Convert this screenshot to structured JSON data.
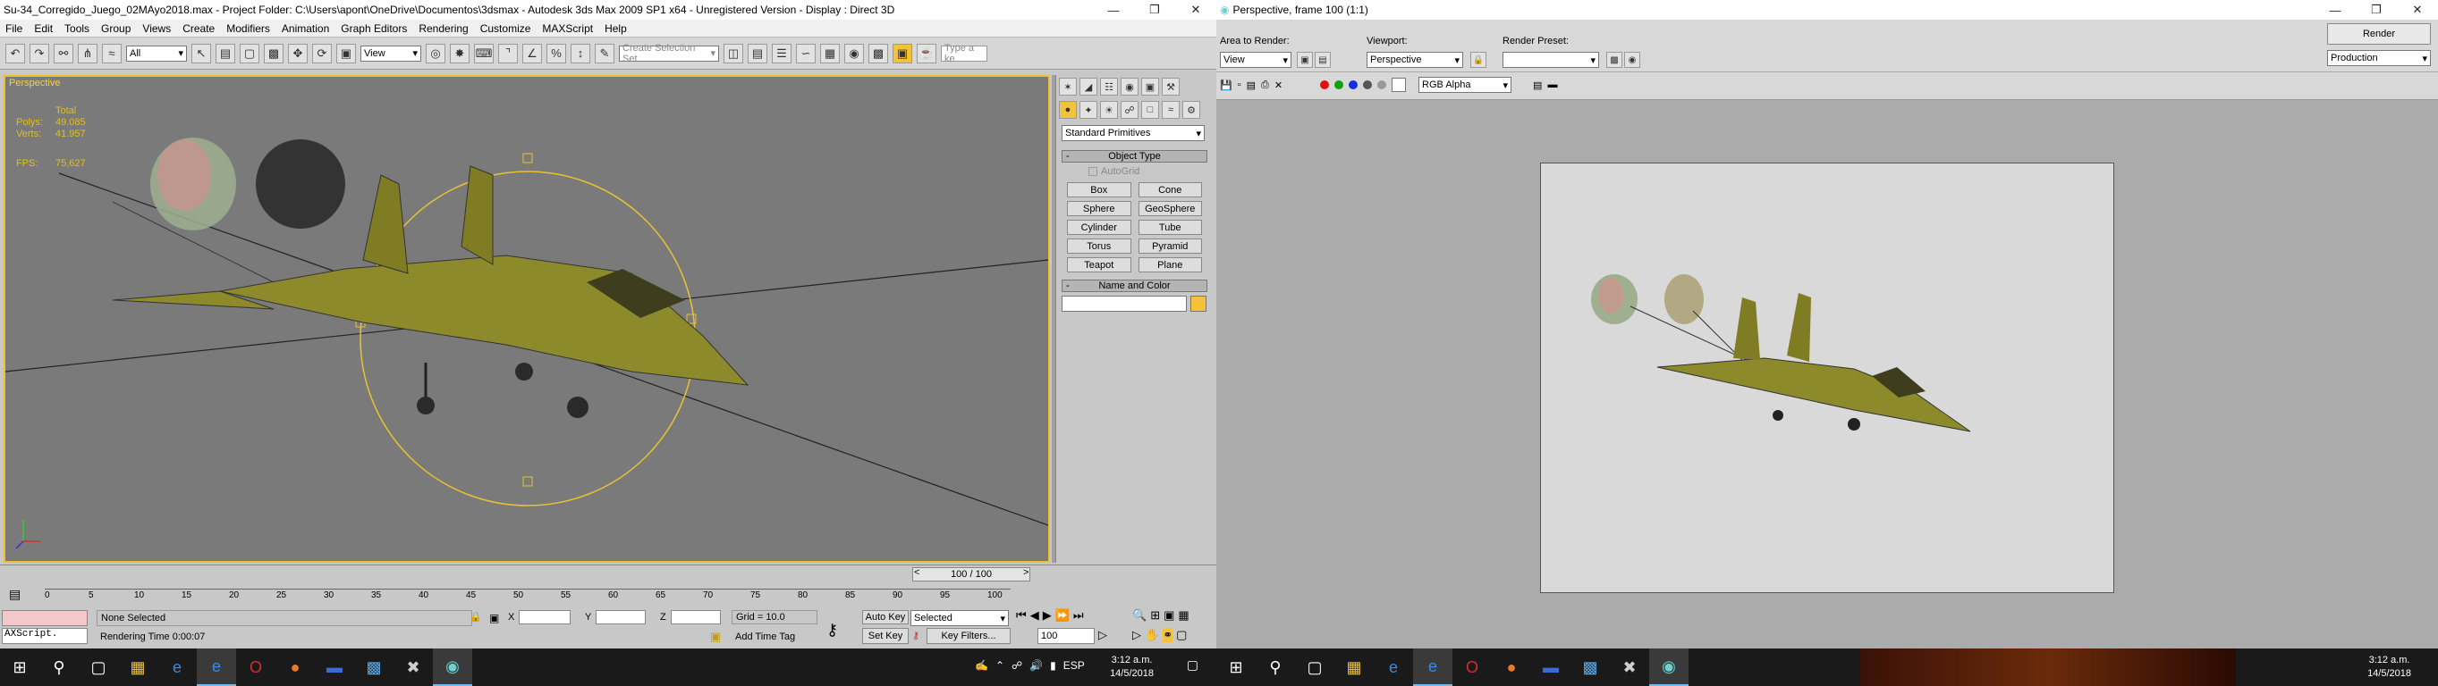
{
  "left": {
    "title": "Su-34_Corregido_Juego_02MAyo2018.max    - Project Folder: C:\\Users\\apont\\OneDrive\\Documentos\\3dsmax    - Autodesk 3ds Max  2009 SP1  x64  - Unregistered Version    - Display : Direct 3D",
    "menu": [
      "File",
      "Edit",
      "Tools",
      "Group",
      "Views",
      "Create",
      "Modifiers",
      "Animation",
      "Graph Editors",
      "Rendering",
      "Customize",
      "MAXScript",
      "Help"
    ],
    "toolbar": {
      "filter": "All",
      "ref_coord": "View",
      "named_sel_placeholder": "Create Selection Set",
      "search_placeholder": "Type a ke"
    },
    "viewport": {
      "label": "Perspective",
      "stats_header": "Total",
      "polys_label": "Polys:",
      "polys": "49.085",
      "verts_label": "Verts:",
      "verts": "41.957",
      "fps_label": "FPS:",
      "fps": "75,627"
    },
    "cmd": {
      "category": "Standard Primitives",
      "object_type_title": "Object Type",
      "autogrid": "AutoGrid",
      "buttons": [
        "Box",
        "Cone",
        "Sphere",
        "GeoSphere",
        "Cylinder",
        "Tube",
        "Torus",
        "Pyramid",
        "Teapot",
        "Plane"
      ],
      "name_color_title": "Name and Color"
    },
    "time": {
      "slider": "100 / 100",
      "ticks": [
        "0",
        "5",
        "10",
        "15",
        "20",
        "25",
        "30",
        "35",
        "40",
        "45",
        "50",
        "55",
        "60",
        "65",
        "70",
        "75",
        "80",
        "85",
        "90",
        "95",
        "100"
      ],
      "status": "None Selected",
      "rendering_time": "Rendering Time  0:00:07",
      "maxscript": "AXScript.",
      "x": "X",
      "y": "Y",
      "z": "Z",
      "grid": "Grid = 10.0",
      "add_time_tag": "Add Time Tag",
      "auto_key": "Auto Key",
      "set_key": "Set Key",
      "selected": "Selected",
      "key_filters": "Key Filters...",
      "frame": "100"
    },
    "taskbar": {
      "time": "3:12 a.m.",
      "date": "14/5/2018",
      "lang": "ESP"
    }
  },
  "right": {
    "title": "Perspective, frame 100 (1:1)",
    "area_label": "Area to Render:",
    "area_value": "View",
    "viewport_label": "Viewport:",
    "viewport_value": "Perspective",
    "preset_label": "Render Preset:",
    "preset_value": "",
    "render_btn": "Render",
    "production": "Production",
    "channel": "RGB Alpha",
    "taskbar": {
      "time": "3:12 a.m.",
      "date": "14/5/2018"
    }
  },
  "colors": {
    "vp_bg": "#7a7a7a",
    "selection": "#f0c030",
    "aircraft": "#8c8a2a",
    "accent_task": "#76b9ed"
  }
}
